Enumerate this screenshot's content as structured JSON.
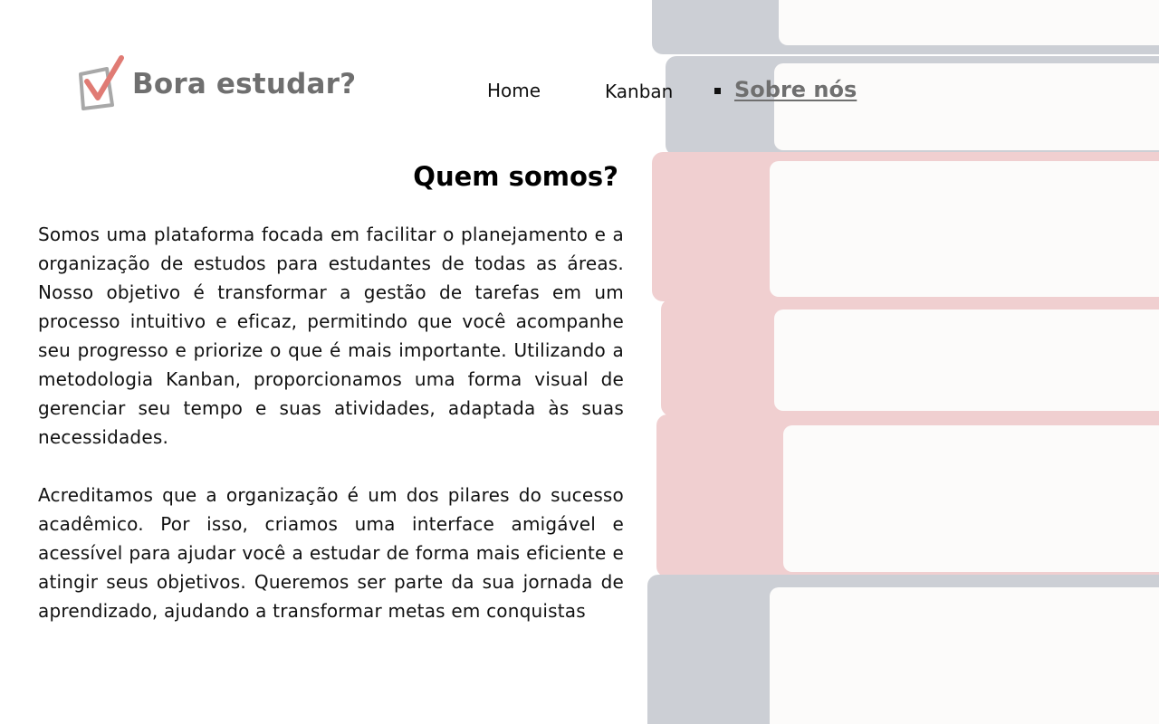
{
  "brand": {
    "title": "Bora estudar?",
    "icon": "checkbox-check-icon",
    "accent_color": "#e07b74",
    "box_color": "#a8a8a8"
  },
  "nav": {
    "items": [
      {
        "label": "Home"
      },
      {
        "label": "Kanban"
      },
      {
        "label": "Sobre nós",
        "active": true
      }
    ]
  },
  "about": {
    "heading": "Quem somos?",
    "paragraphs": [
      "Somos uma plataforma focada em facilitar o planejamento e a organização de estudos para estudantes de todas as áreas. Nosso objetivo é transformar a gestão de tarefas em um processo intuitivo e eficaz, permitindo que você acompanhe seu progresso e priorize o que é mais importante. Utilizando a metodologia Kanban, proporcionamos uma forma visual de gerenciar seu tempo e suas atividades, adaptada às suas necessidades.",
      "Acreditamos que a organização é um dos pilares do sucesso acadêmico. Por isso, criamos uma interface amigável e acessível para ajudar você a estudar de forma mais eficiente e atingir seus objetivos. Queremos ser parte da sua jornada de aprendizado, ajudando a transformar metas em conquistas"
    ]
  },
  "background": {
    "image": "stack-of-books-image",
    "cover_colors": [
      "#1e2a44",
      "#c0282e",
      "#c0282e",
      "#1e2a44",
      "#c0282e",
      "#c0282e",
      "#1e2a44"
    ]
  }
}
